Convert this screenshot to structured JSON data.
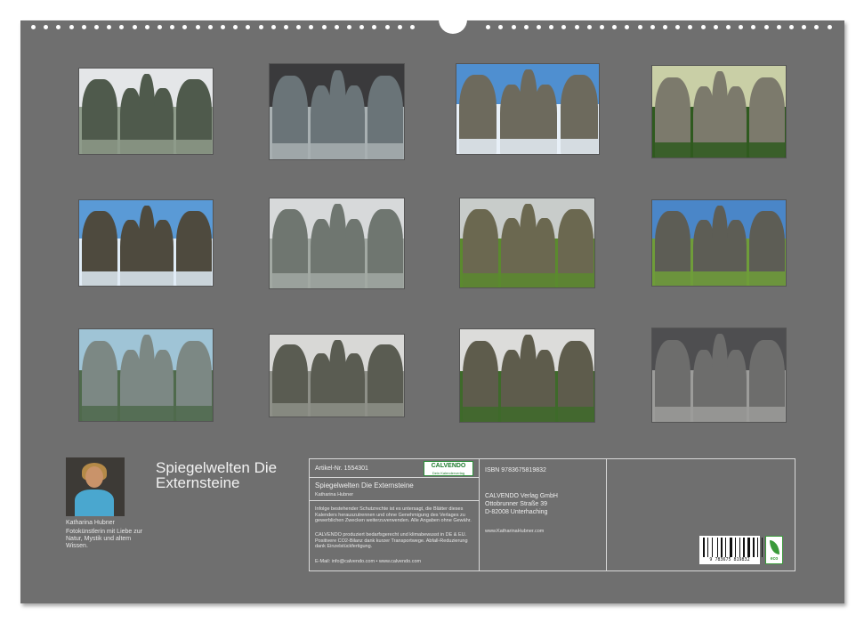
{
  "title": "Spiegelwelten Die Externsteine",
  "author": {
    "name": "Katharina Hubner",
    "bio": "Fotokünstlerin mit Liebe zur Natur, Mystik und altem Wissen."
  },
  "thumbnails": [
    {
      "name": "photo-jan",
      "sky": "#e4e6e8",
      "rock": "#4f5a4c",
      "accent": "#8e9b8a"
    },
    {
      "name": "photo-feb",
      "sky": "#3a3a3c",
      "rock": "#6a7478",
      "accent": "#a8b0b2"
    },
    {
      "name": "photo-mar",
      "sky": "#4f8fd0",
      "rock": "#6d6a5d",
      "accent": "#e8f0f8"
    },
    {
      "name": "photo-apr",
      "sky": "#c9cfa6",
      "rock": "#7c7a6c",
      "accent": "#2f5a1f"
    },
    {
      "name": "photo-may",
      "sky": "#5a9ad6",
      "rock": "#4e4a3e",
      "accent": "#e0ecf6"
    },
    {
      "name": "photo-jun",
      "sky": "#d7d9da",
      "rock": "#6f7670",
      "accent": "#a2a9a3"
    },
    {
      "name": "photo-jul",
      "sky": "#c8ccca",
      "rock": "#6b6850",
      "accent": "#5b8a2e"
    },
    {
      "name": "photo-aug",
      "sky": "#4a86c8",
      "rock": "#5d5d55",
      "accent": "#6f9d3a"
    },
    {
      "name": "photo-sep",
      "sky": "#9fc4d6",
      "rock": "#7c8884",
      "accent": "#4f6a4c"
    },
    {
      "name": "photo-oct",
      "sky": "#d8d8d6",
      "rock": "#5a5c52",
      "accent": "#8e9088"
    },
    {
      "name": "photo-nov",
      "sky": "#dcdcda",
      "rock": "#5e5c4c",
      "accent": "#3e6a2a"
    },
    {
      "name": "photo-dec",
      "sky": "#4e4e50",
      "rock": "#6d6d6c",
      "accent": "#9c9c9a"
    }
  ],
  "info": {
    "article_label": "Artikel-Nr. 1554301",
    "calvendo_logo": "CALVENDO",
    "calvendo_tagline": "Dein Kalenderverlag",
    "calendar_title": "Spiegelwelten Die Externsteine",
    "calendar_author": "Katharina Hubner",
    "legal_text": "Infolge bestehender Schutzrechte ist es untersagt, die Blätter dieses Kalenders herauszutrennen und ohne Genehmigung des Verlages zu gewerblichen Zwecken weiterzuverwenden. Alle Angaben ohne Gewähr.",
    "eco_text": "CALVENDO produziert bedarfsgerecht und klimabewusst in DE & EU. Positivere CO2-Bilanz dank kurzer Transportwege. Abfall-Reduzierung dank Einzelstückfertigung.",
    "contact": "E-Mail: info@calvendo.com • www.calvendo.com",
    "isbn": "ISBN 9783675819832",
    "publisher_name": "CALVENDO Verlag GmbH",
    "publisher_street": "Ottobrunner Straße 39",
    "publisher_city": "D-82008 Unterhaching",
    "author_url": "www.KatharinaHubner.com",
    "barcode_number": "9 783675 819832",
    "eco_label": "eco"
  }
}
